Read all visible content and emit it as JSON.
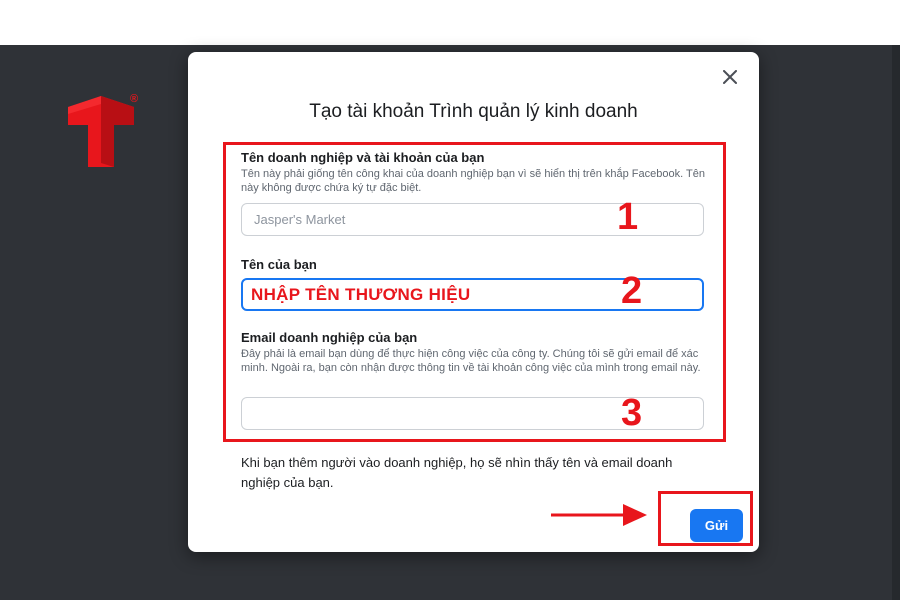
{
  "modal": {
    "title": "Tạo tài khoản Trình quản lý kinh doanh",
    "close_icon": "close-icon"
  },
  "business": {
    "label": "Tên doanh nghiệp và tài khoản của bạn",
    "help": "Tên này phải giống tên công khai của doanh nghiệp bạn vì sẽ hiển thị trên khắp Facebook. Tên này không được chứa ký tự đặc biệt.",
    "placeholder": "Jasper's Market",
    "value": ""
  },
  "your_name": {
    "label": "Tên của bạn",
    "value": "NHẬP TÊN THƯƠNG HIỆU"
  },
  "email": {
    "label": "Email doanh nghiệp của bạn",
    "help": "Đây phải là email bạn dùng để thực hiện công việc của công ty. Chúng tôi sẽ gửi email để xác minh. Ngoài ra, bạn còn nhận được thông tin về tài khoản công việc của mình trong email này.",
    "value": ""
  },
  "footer_note": "Khi bạn thêm người vào doanh nghiệp, họ sẽ nhìn thấy tên và email doanh nghiệp của bạn.",
  "submit_label": "Gửi",
  "annotations": {
    "step1": "1",
    "step2": "2",
    "step3": "3",
    "highlight_color": "#e8161c"
  },
  "brand": {
    "logo_letter": "T",
    "registered_mark": "®",
    "logo_color": "#e8161c"
  }
}
